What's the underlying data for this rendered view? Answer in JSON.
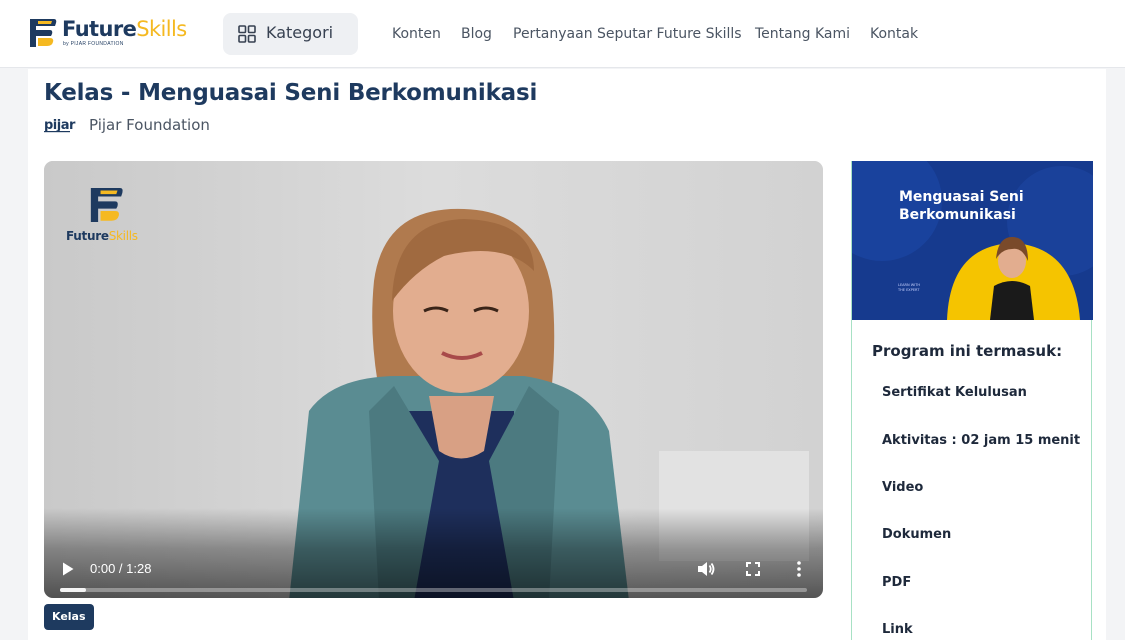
{
  "header": {
    "logo": {
      "word_primary": "Future",
      "word_secondary": "Skills",
      "tagline": "by PIJAR FOUNDATION"
    },
    "kategori_label": "Kategori",
    "nav": [
      "Konten",
      "Blog",
      "Pertanyaan Seputar Future Skills",
      "Tentang Kami",
      "Kontak"
    ]
  },
  "course": {
    "title": "Kelas - Menguasai Seni Berkomunikasi",
    "org_logo_text": "pijar",
    "org_name": "Pijar Foundation",
    "tag": "Kelas"
  },
  "video": {
    "watermark_primary": "Future",
    "watermark_secondary": "Skills",
    "time": "0:00 / 1:28",
    "progress": 0.035
  },
  "sidebar": {
    "thumbnail_title": "Menguasai Seni Berkomunikasi",
    "thumbnail_small_text": "LEARN WITH THE EXPERT",
    "includes_title": "Program ini termasuk:",
    "items": [
      "Sertifikat Kelulusan",
      "Aktivitas : 02 jam 15 menit",
      "Video",
      "Dokumen",
      "PDF",
      "Link"
    ]
  },
  "colors": {
    "brand_navy": "#1e3a5f",
    "brand_yellow": "#f5b921",
    "card_border": "#a7e1c4",
    "thumbnail_blue": "#163a8e"
  }
}
